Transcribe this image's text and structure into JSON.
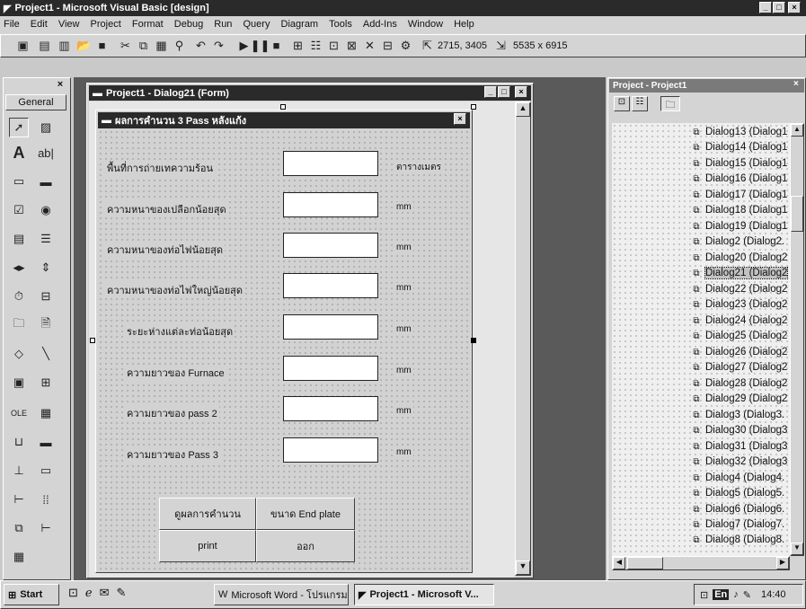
{
  "window": {
    "title": "Project1 - Microsoft Visual Basic [design]"
  },
  "menu": [
    "File",
    "Edit",
    "View",
    "Project",
    "Format",
    "Debug",
    "Run",
    "Query",
    "Diagram",
    "Tools",
    "Add-Ins",
    "Window",
    "Help"
  ],
  "toolbar": {
    "position_readout": "2715, 3405",
    "size_readout": "5535 x 6915"
  },
  "toolbox": {
    "title": "General"
  },
  "form_window": {
    "title": "Project1 - Dialog21 (Form)"
  },
  "dialog": {
    "caption": "ผลการคำนวน 3 Pass หลังแก้ง",
    "rows": [
      {
        "label": "พื้นที่การถ่ายเทความร้อน",
        "unit": "ตารางเมตร"
      },
      {
        "label": "ความหนาของเปลือกน้อยสุด",
        "unit": "mm"
      },
      {
        "label": "ความหนาของท่อไฟน้อยสุด",
        "unit": "mm"
      },
      {
        "label": "ความหนาของท่อไฟใหญ่น้อยสุด",
        "unit": "mm"
      },
      {
        "label": "ระยะห่างแต่ละท่อน้อยสุด",
        "unit": "mm"
      },
      {
        "label": "ความยาวของ Furnace",
        "unit": "mm"
      },
      {
        "label": "ความยาวของ pass 2",
        "unit": "mm"
      },
      {
        "label": "ความยาวของ Pass 3",
        "unit": "mm"
      }
    ],
    "buttons": {
      "view_results": "ดูผลการคำนวน",
      "end_plate": "ขนาด End plate",
      "print": "print",
      "exit": "ออก"
    }
  },
  "project_explorer": {
    "title": "Project - Project1",
    "items": [
      "Dialog13 (Dialog1",
      "Dialog14 (Dialog1",
      "Dialog15 (Dialog1",
      "Dialog16 (Dialog1",
      "Dialog17 (Dialog1",
      "Dialog18 (Dialog1",
      "Dialog19 (Dialog1",
      "Dialog2 (Dialog2.",
      "Dialog20 (Dialog2",
      "Dialog21 (Dialog2",
      "Dialog22 (Dialog2",
      "Dialog23 (Dialog2",
      "Dialog24 (Dialog2",
      "Dialog25 (Dialog2",
      "Dialog26 (Dialog2",
      "Dialog27 (Dialog2",
      "Dialog28 (Dialog2",
      "Dialog29 (Dialog2",
      "Dialog3 (Dialog3.",
      "Dialog30 (Dialog3",
      "Dialog31 (Dialog3",
      "Dialog32 (Dialog3",
      "Dialog4 (Dialog4.",
      "Dialog5 (Dialog5.",
      "Dialog6 (Dialog6.",
      "Dialog7 (Dialog7.",
      "Dialog8 (Dialog8."
    ],
    "selected": "Dialog21 (Dialog2"
  },
  "taskbar": {
    "start": "Start",
    "tasks": [
      "Microsoft Word - โปรแกรม...",
      "Project1 - Microsoft V..."
    ],
    "language": "En",
    "clock": "14:40"
  }
}
